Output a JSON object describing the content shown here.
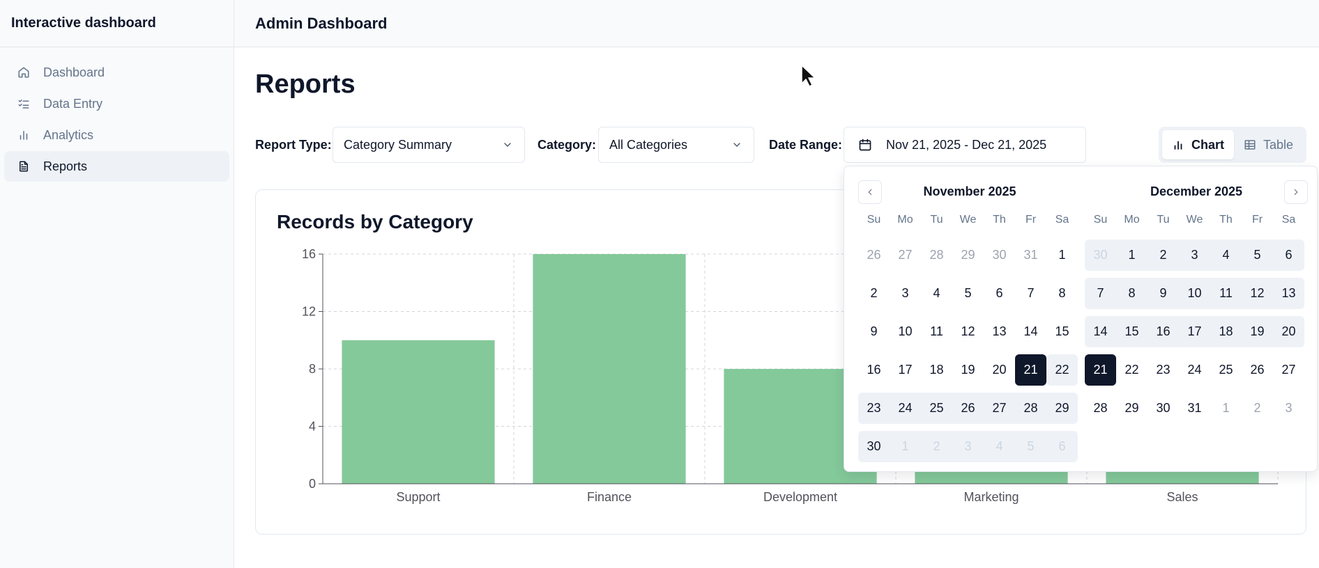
{
  "sidebar": {
    "brand": "Interactive dashboard",
    "items": [
      {
        "label": "Dashboard",
        "icon": "home-icon"
      },
      {
        "label": "Data Entry",
        "icon": "list-checks-icon"
      },
      {
        "label": "Analytics",
        "icon": "bar-chart-icon"
      },
      {
        "label": "Reports",
        "icon": "file-text-icon",
        "active": true
      }
    ]
  },
  "header": {
    "title": "Admin Dashboard"
  },
  "page": {
    "title": "Reports"
  },
  "filters": {
    "report_type_label": "Report Type:",
    "report_type_value": "Category Summary",
    "category_label": "Category:",
    "category_value": "All Categories",
    "date_range_label": "Date Range:",
    "date_range_value": "Nov 21, 2025 - Dec 21, 2025"
  },
  "view_toggle": {
    "chart_label": "Chart",
    "table_label": "Table",
    "active": "chart"
  },
  "card": {
    "title": "Records by Category"
  },
  "chart_data": {
    "type": "bar",
    "categories": [
      "Support",
      "Finance",
      "Development",
      "Marketing",
      "Sales"
    ],
    "values": [
      10,
      16,
      8,
      8,
      8
    ],
    "ylim": [
      0,
      16
    ],
    "yticks": [
      0,
      4,
      8,
      12,
      16
    ],
    "grid": true,
    "bar_color": "#84c99a"
  },
  "calendar": {
    "weekdays": [
      "Su",
      "Mo",
      "Tu",
      "We",
      "Th",
      "Fr",
      "Sa"
    ],
    "months": [
      {
        "title": "November 2025",
        "weeks": [
          [
            {
              "d": "26",
              "out": true
            },
            {
              "d": "27",
              "out": true
            },
            {
              "d": "28",
              "out": true
            },
            {
              "d": "29",
              "out": true
            },
            {
              "d": "30",
              "out": true
            },
            {
              "d": "31",
              "out": true
            },
            {
              "d": "1"
            }
          ],
          [
            {
              "d": "2"
            },
            {
              "d": "3"
            },
            {
              "d": "4"
            },
            {
              "d": "5"
            },
            {
              "d": "6"
            },
            {
              "d": "7"
            },
            {
              "d": "8"
            }
          ],
          [
            {
              "d": "9"
            },
            {
              "d": "10"
            },
            {
              "d": "11"
            },
            {
              "d": "12"
            },
            {
              "d": "13"
            },
            {
              "d": "14"
            },
            {
              "d": "15"
            }
          ],
          [
            {
              "d": "16"
            },
            {
              "d": "17"
            },
            {
              "d": "18"
            },
            {
              "d": "19"
            },
            {
              "d": "20"
            },
            {
              "d": "21",
              "sel": true
            },
            {
              "d": "22",
              "range": true
            }
          ],
          [
            {
              "d": "23",
              "range": true
            },
            {
              "d": "24",
              "range": true
            },
            {
              "d": "25",
              "range": true
            },
            {
              "d": "26",
              "range": true
            },
            {
              "d": "27",
              "range": true
            },
            {
              "d": "28",
              "range": true
            },
            {
              "d": "29",
              "range": true
            }
          ],
          [
            {
              "d": "30",
              "range": true
            },
            {
              "d": "1",
              "out": true,
              "range": true
            },
            {
              "d": "2",
              "out": true,
              "range": true
            },
            {
              "d": "3",
              "out": true,
              "range": true
            },
            {
              "d": "4",
              "out": true,
              "range": true
            },
            {
              "d": "5",
              "out": true,
              "range": true
            },
            {
              "d": "6",
              "out": true,
              "range": true
            }
          ]
        ]
      },
      {
        "title": "December 2025",
        "weeks": [
          [
            {
              "d": "30",
              "out": true,
              "range": true
            },
            {
              "d": "1",
              "range": true
            },
            {
              "d": "2",
              "range": true
            },
            {
              "d": "3",
              "range": true
            },
            {
              "d": "4",
              "range": true
            },
            {
              "d": "5",
              "range": true
            },
            {
              "d": "6",
              "range": true
            }
          ],
          [
            {
              "d": "7",
              "range": true
            },
            {
              "d": "8",
              "range": true
            },
            {
              "d": "9",
              "range": true
            },
            {
              "d": "10",
              "range": true
            },
            {
              "d": "11",
              "range": true
            },
            {
              "d": "12",
              "range": true
            },
            {
              "d": "13",
              "range": true
            }
          ],
          [
            {
              "d": "14",
              "range": true
            },
            {
              "d": "15",
              "range": true
            },
            {
              "d": "16",
              "range": true
            },
            {
              "d": "17",
              "range": true
            },
            {
              "d": "18",
              "range": true
            },
            {
              "d": "19",
              "range": true
            },
            {
              "d": "20",
              "range": true
            }
          ],
          [
            {
              "d": "21",
              "sel": true
            },
            {
              "d": "22"
            },
            {
              "d": "23"
            },
            {
              "d": "24"
            },
            {
              "d": "25"
            },
            {
              "d": "26"
            },
            {
              "d": "27"
            }
          ],
          [
            {
              "d": "28"
            },
            {
              "d": "29"
            },
            {
              "d": "30"
            },
            {
              "d": "31"
            },
            {
              "d": "1",
              "out": true
            },
            {
              "d": "2",
              "out": true
            },
            {
              "d": "3",
              "out": true
            }
          ]
        ]
      }
    ]
  },
  "colors": {
    "primary": "#0f172a",
    "muted": "#64748b",
    "range": "#eef2f7",
    "bar": "#84c99a"
  }
}
